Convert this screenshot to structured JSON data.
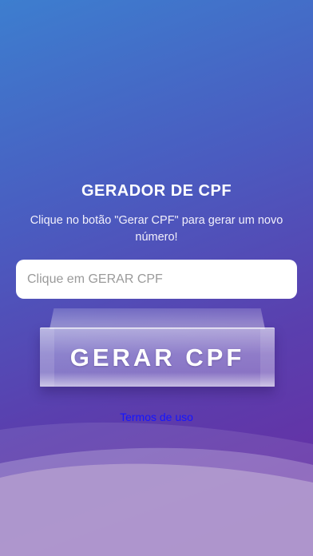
{
  "screen": {
    "title": "GERADOR DE CPF",
    "subtitle": "Clique no botão \"Gerar CPF\" para gerar um novo número!"
  },
  "cpf_field": {
    "value": "",
    "placeholder": "Clique em GERAR CPF"
  },
  "generate_button": {
    "label": "GERAR CPF"
  },
  "footer": {
    "terms_link": "Termos de uso"
  },
  "colors": {
    "gradient_start": "#3d7ecf",
    "gradient_end": "#6a2aa0",
    "link": "#1515ff",
    "wave_light": "#c3acd8"
  }
}
